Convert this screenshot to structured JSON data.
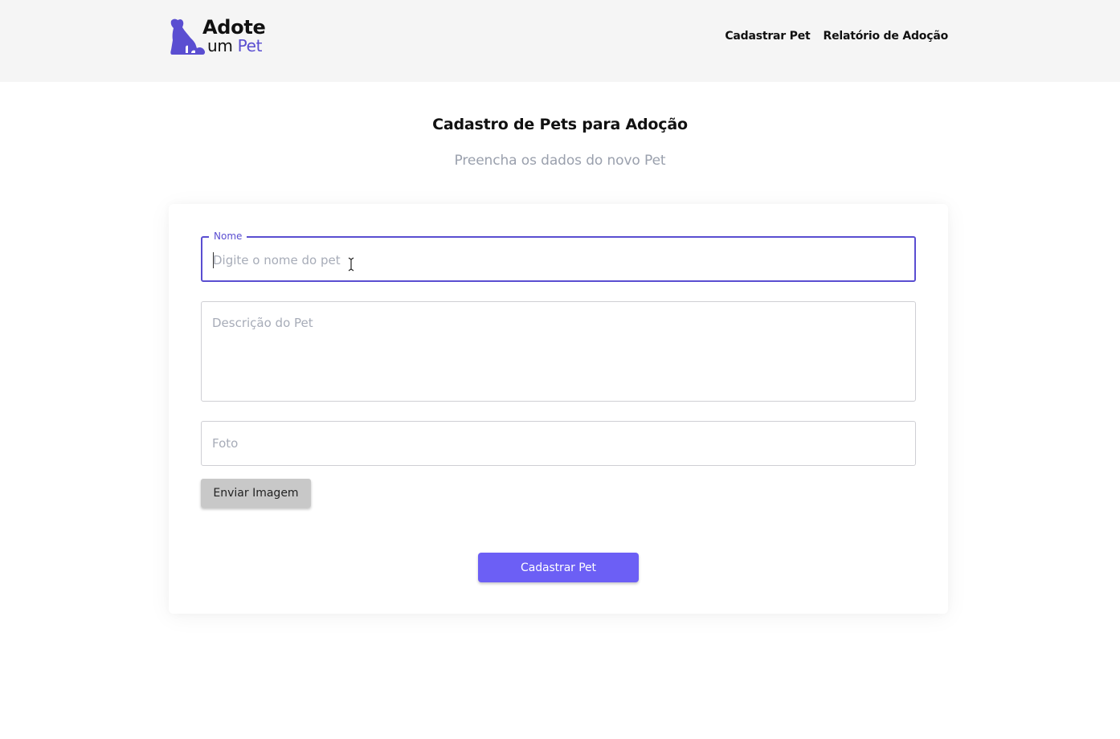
{
  "brand": {
    "line1": "Adote",
    "line2_prefix": "um",
    "line2_accent": "Pet",
    "accent_color": "#5a4ed1",
    "icon": "dog-icon"
  },
  "nav": {
    "items": [
      {
        "label": "Cadastrar Pet"
      },
      {
        "label": "Relatório de Adoção"
      }
    ]
  },
  "main": {
    "title": "Cadastro de Pets para Adoção",
    "subtitle": "Preencha os dados do novo Pet"
  },
  "form": {
    "name": {
      "label": "Nome",
      "placeholder": "Digite o nome do pet",
      "value": ""
    },
    "description": {
      "placeholder": "Descrição do Pet",
      "value": ""
    },
    "photo": {
      "placeholder": "Foto",
      "value": ""
    },
    "upload_label": "Enviar Imagem",
    "submit_label": "Cadastrar Pet"
  },
  "colors": {
    "primary": "#6c5ff5",
    "focus": "#5a4ed1",
    "header_bg": "#f5f5f5",
    "upload_bg": "#c8c8c8"
  }
}
